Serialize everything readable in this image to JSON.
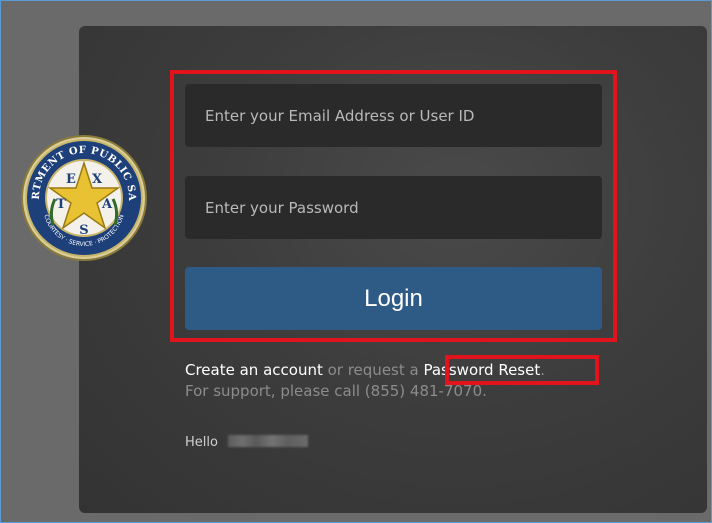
{
  "login": {
    "email_placeholder": "Enter your Email Address or User ID",
    "password_placeholder": "Enter your Password",
    "login_label": "Login"
  },
  "footer": {
    "create_account": "Create an account",
    "or_request": " or request a ",
    "password_reset": "Password Reset",
    "period": ".",
    "support": "For support, please call (855) 481-7070.",
    "hello": "Hello"
  },
  "seal": {
    "top_text": "DEPARTMENT OF PUBLIC SAFETY",
    "bottom_text": "COURTESY · SERVICE · PROTECTION",
    "letters": [
      "T",
      "E",
      "X",
      "A",
      "S"
    ]
  },
  "colors": {
    "accent_button": "#2d5b86",
    "annotation_red": "#e1141e",
    "card_bg": "#3d3d3d"
  }
}
